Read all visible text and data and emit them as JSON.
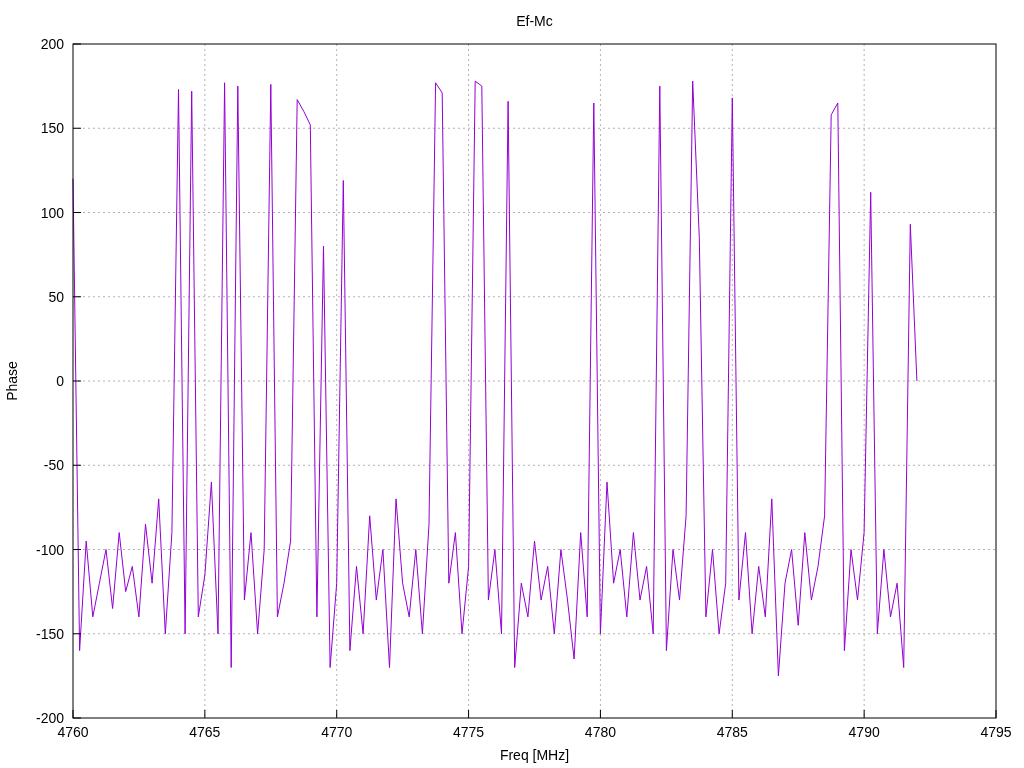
{
  "chart_data": {
    "type": "line",
    "title": "Ef-Mc",
    "xlabel": "Freq [MHz]",
    "ylabel": "Phase",
    "grid": true,
    "xlim": [
      4760,
      4795
    ],
    "ylim": [
      -200,
      200
    ],
    "xticks": [
      4760,
      4765,
      4770,
      4775,
      4780,
      4785,
      4790,
      4795
    ],
    "yticks": [
      -200,
      -150,
      -100,
      -50,
      0,
      50,
      100,
      150,
      200
    ],
    "x": [
      4760,
      4760.25,
      4760.5,
      4760.75,
      4761,
      4761.25,
      4761.5,
      4761.75,
      4762,
      4762.25,
      4762.5,
      4762.75,
      4763,
      4763.25,
      4763.5,
      4763.75,
      4764,
      4764.25,
      4764.5,
      4764.75,
      4765,
      4765.25,
      4765.5,
      4765.75,
      4766,
      4766.25,
      4766.5,
      4766.75,
      4767,
      4767.25,
      4767.5,
      4767.75,
      4768,
      4768.25,
      4768.5,
      4768.75,
      4769,
      4769.25,
      4769.5,
      4769.75,
      4770,
      4770.25,
      4770.5,
      4770.75,
      4771,
      4771.25,
      4771.5,
      4771.75,
      4772,
      4772.25,
      4772.5,
      4772.75,
      4773,
      4773.25,
      4773.5,
      4773.75,
      4774,
      4774.25,
      4774.5,
      4774.75,
      4775,
      4775.25,
      4775.5,
      4775.75,
      4776,
      4776.25,
      4776.5,
      4776.75,
      4777,
      4777.25,
      4777.5,
      4777.75,
      4778,
      4778.25,
      4778.5,
      4778.75,
      4779,
      4779.25,
      4779.5,
      4779.75,
      4780,
      4780.25,
      4780.5,
      4780.75,
      4781,
      4781.25,
      4781.5,
      4781.75,
      4782,
      4782.25,
      4782.5,
      4782.75,
      4783,
      4783.25,
      4783.5,
      4783.75,
      4784,
      4784.25,
      4784.5,
      4784.75,
      4785,
      4785.25,
      4785.5,
      4785.75,
      4786,
      4786.25,
      4786.5,
      4786.75,
      4787,
      4787.25,
      4787.5,
      4787.75,
      4788,
      4788.25,
      4788.5,
      4788.75,
      4789,
      4789.25,
      4789.5,
      4789.75,
      4790,
      4790.25,
      4790.5,
      4790.75,
      4791,
      4791.25,
      4791.5,
      4791.75,
      4792
    ],
    "series": [
      {
        "color": "#9400d3",
        "values": [
          120,
          -160,
          -95,
          -140,
          -120,
          -100,
          -135,
          -90,
          -125,
          -110,
          -140,
          -85,
          -120,
          -70,
          -150,
          -90,
          173,
          -150,
          172,
          -140,
          -115,
          -60,
          -150,
          177,
          -170,
          175,
          -130,
          -90,
          -150,
          -100,
          176,
          -140,
          -120,
          -95,
          167,
          160,
          152,
          -140,
          80,
          -170,
          -120,
          119,
          -160,
          -110,
          -150,
          -80,
          -130,
          -100,
          -170,
          -70,
          -120,
          -140,
          -100,
          -150,
          -85,
          177,
          171,
          -120,
          -90,
          -150,
          -110,
          178,
          175,
          -130,
          -100,
          -150,
          166,
          -170,
          -120,
          -140,
          -95,
          -130,
          -110,
          -150,
          -100,
          -130,
          -165,
          -90,
          -140,
          165,
          -150,
          -60,
          -120,
          -100,
          -140,
          -90,
          -130,
          -110,
          -150,
          175,
          -160,
          -100,
          -130,
          -80,
          178,
          85,
          -140,
          -100,
          -150,
          -120,
          168,
          -130,
          -90,
          -150,
          -110,
          -140,
          -70,
          -175,
          -120,
          -100,
          -145,
          -90,
          -130,
          -110,
          -80,
          158,
          165,
          -160,
          -100,
          -130,
          -90,
          112,
          -150,
          -100,
          -140,
          -120,
          -170,
          93,
          0
        ]
      }
    ]
  }
}
